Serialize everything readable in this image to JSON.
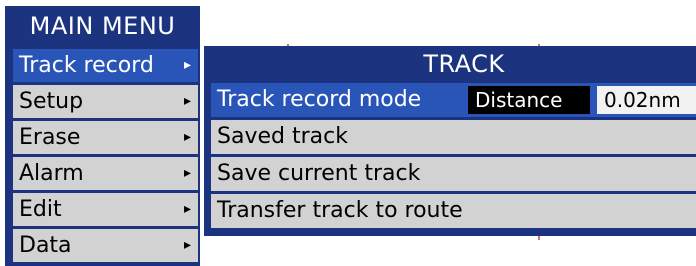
{
  "main_menu": {
    "title": "MAIN MENU",
    "items": [
      {
        "label": "Track record",
        "arrow": "▸",
        "selected": true
      },
      {
        "label": "Setup",
        "arrow": "▸",
        "selected": false
      },
      {
        "label": "Erase",
        "arrow": "▸",
        "selected": false
      },
      {
        "label": "Alarm",
        "arrow": "▸",
        "selected": false
      },
      {
        "label": "Edit",
        "arrow": "▸",
        "selected": false
      },
      {
        "label": "Data",
        "arrow": "▸",
        "selected": false
      }
    ]
  },
  "track_menu": {
    "title": "TRACK",
    "items": [
      {
        "label": "Track record mode",
        "value": "Distance",
        "interval": "0.02nm",
        "selected": true
      },
      {
        "label": "Saved track",
        "selected": false
      },
      {
        "label": "Save current track",
        "selected": false
      },
      {
        "label": "Transfer track to route",
        "selected": false
      }
    ]
  },
  "colors": {
    "menu_background": "#1c3380",
    "selected_item": "#2a55b8",
    "item_background": "#d2d2d2",
    "value_background": "#000000"
  }
}
